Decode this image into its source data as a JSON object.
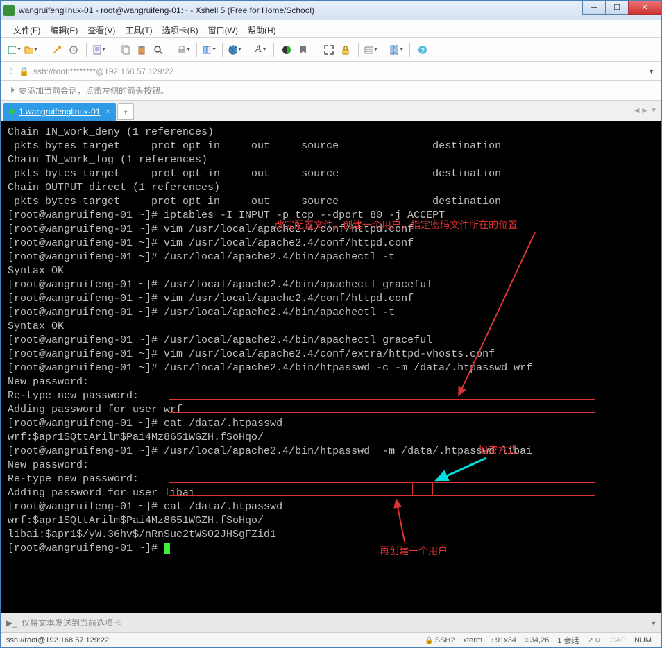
{
  "window": {
    "title": "wangruifenglinux-01 - root@wangruifeng-01:~ - Xshell 5 (Free for Home/School)"
  },
  "menu": {
    "file": "文件(F)",
    "edit": "编辑(E)",
    "view": "查看(V)",
    "tools": "工具(T)",
    "tabs": "选项卡(B)",
    "window": "窗口(W)",
    "help": "帮助(H)"
  },
  "addr": {
    "text": "ssh://root:********@192.168.57.129:22"
  },
  "hint": {
    "text": "要添加当前会话，点击左侧的箭头按钮。"
  },
  "tab": {
    "label": "1 wangruifenglinux-01"
  },
  "tabadd": "+",
  "annotations": {
    "a1": "改完配置文件，创建一个用户，指定密码文件所在的位置",
    "a2": "加密方式",
    "a3": "再创建一个用户"
  },
  "terminal_lines": [
    "",
    "Chain IN_work_deny (1 references)",
    " pkts bytes target     prot opt in     out     source               destination",
    "",
    "Chain IN_work_log (1 references)",
    " pkts bytes target     prot opt in     out     source               destination",
    "",
    "Chain OUTPUT_direct (1 references)",
    " pkts bytes target     prot opt in     out     source               destination",
    "[root@wangruifeng-01 ~]# iptables -I INPUT -p tcp --dport 80 -j ACCEPT",
    "[root@wangruifeng-01 ~]# vim /usr/local/apache2.4/conf/httpd.conf",
    "[root@wangruifeng-01 ~]# vim /usr/local/apache2.4/conf/httpd.conf",
    "[root@wangruifeng-01 ~]# /usr/local/apache2.4/bin/apachectl -t",
    "Syntax OK",
    "[root@wangruifeng-01 ~]# /usr/local/apache2.4/bin/apachectl graceful",
    "[root@wangruifeng-01 ~]# vim /usr/local/apache2.4/conf/httpd.conf",
    "[root@wangruifeng-01 ~]# /usr/local/apache2.4/bin/apachectl -t",
    "Syntax OK",
    "[root@wangruifeng-01 ~]# /usr/local/apache2.4/bin/apachectl graceful",
    "[root@wangruifeng-01 ~]# vim /usr/local/apache2.4/conf/extra/httpd-vhosts.conf",
    "[root@wangruifeng-01 ~]# /usr/local/apache2.4/bin/htpasswd -c -m /data/.htpasswd wrf",
    "New password:",
    "Re-type new password:",
    "Adding password for user wrf",
    "[root@wangruifeng-01 ~]# cat /data/.htpasswd",
    "wrf:$apr1$QttArilm$Pai4Mz8651WGZH.fSoHqo/",
    "[root@wangruifeng-01 ~]# /usr/local/apache2.4/bin/htpasswd  -m /data/.htpasswd libai",
    "New password:",
    "Re-type new password:",
    "Adding password for user libai",
    "[root@wangruifeng-01 ~]# cat /data/.htpasswd",
    "wrf:$apr1$QttArilm$Pai4Mz8651WGZH.fSoHqo/",
    "libai:$apr1$/yW.36hv$/nRnSuc2tWSO2JHSgFZid1",
    "[root@wangruifeng-01 ~]# "
  ],
  "input": {
    "placeholder": "仅将文本发送到当前选项卡"
  },
  "status": {
    "conn": "ssh://root@192.168.57.129:22",
    "proto": "SSH2",
    "term": "xterm",
    "size": "91x34",
    "pos": "34,26",
    "sess": "1 会话",
    "caps": "CAP",
    "num": "NUM"
  }
}
